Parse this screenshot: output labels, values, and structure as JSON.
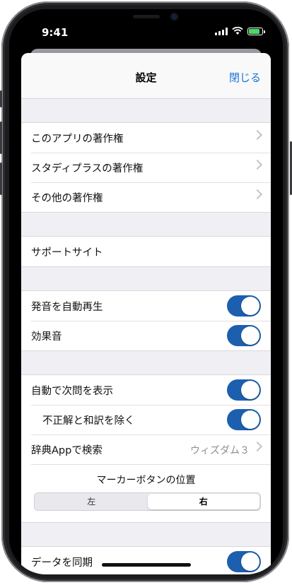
{
  "status": {
    "time": "9:41"
  },
  "nav": {
    "title": "設定",
    "close": "閉じる"
  },
  "copyright": [
    {
      "label": "このアプリの著作権"
    },
    {
      "label": "スタディプラスの著作権"
    },
    {
      "label": "その他の著作権"
    }
  ],
  "support": {
    "label": "サポートサイト"
  },
  "sound": [
    {
      "label": "発音を自動再生",
      "on": true
    },
    {
      "label": "効果音",
      "on": true
    }
  ],
  "study": {
    "auto_next": {
      "label": "自動で次問を表示",
      "on": true
    },
    "exclude": {
      "label": "不正解と和訳を除く",
      "on": true
    },
    "dictionary": {
      "label": "辞典Appで検索",
      "value": "ウィズダム３"
    }
  },
  "marker": {
    "title": "マーカーボタンの位置",
    "options": [
      "左",
      "右"
    ],
    "selected": "右"
  },
  "sync": {
    "label": "データを同期",
    "on": true
  },
  "colors": {
    "accent": "#1a73d9",
    "toggle": "#1c5fae",
    "background": "#efeff4"
  },
  "icons": [
    "signal-icon",
    "wifi-icon",
    "battery-icon",
    "chevron-right-icon"
  ]
}
